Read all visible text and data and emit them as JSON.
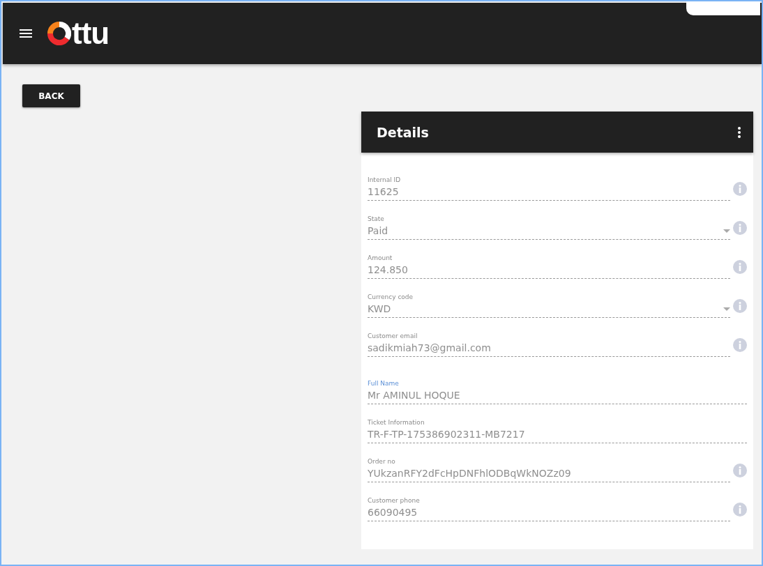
{
  "header": {
    "logo_text": "ttu"
  },
  "back_button": "BACK",
  "details": {
    "title": "Details",
    "fields": [
      {
        "label": "Internal ID",
        "value": "11625",
        "kind": "text",
        "info": true,
        "focused": false
      },
      {
        "label": "State",
        "value": "Paid",
        "kind": "select",
        "info": true,
        "focused": false
      },
      {
        "label": "Amount",
        "value": "124.850",
        "kind": "text",
        "info": true,
        "focused": false
      },
      {
        "label": "Currency code",
        "value": "KWD",
        "kind": "select",
        "info": true,
        "focused": false
      },
      {
        "label": "Customer email",
        "value": "sadikmiah73@gmail.com",
        "kind": "text",
        "info": true,
        "focused": false
      },
      {
        "label": "Full Name",
        "value": "Mr AMINUL HOQUE",
        "kind": "text",
        "info": false,
        "focused": true
      },
      {
        "label": "Ticket Information",
        "value": "TR-F-TP-175386902311-MB7217",
        "kind": "text",
        "info": false,
        "focused": false
      },
      {
        "label": "Order no",
        "value": "YUkzanRFY2dFcHpDNFhlODBqWkNOZz09",
        "kind": "text",
        "info": true,
        "focused": false
      },
      {
        "label": "Customer phone",
        "value": "66090495",
        "kind": "text",
        "info": true,
        "focused": false
      }
    ]
  }
}
